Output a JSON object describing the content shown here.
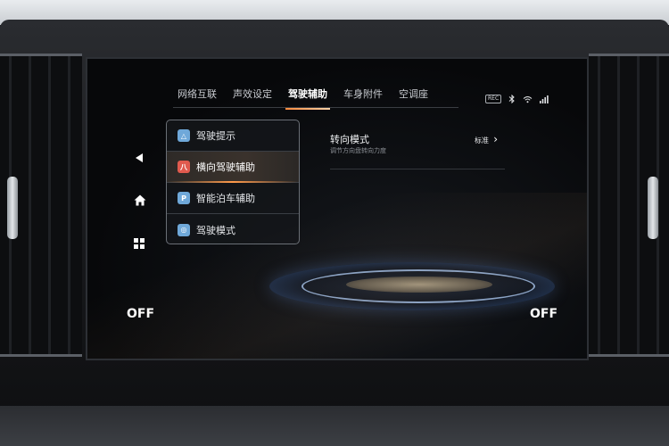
{
  "tabs": [
    {
      "label": "网络互联"
    },
    {
      "label": "声效设定"
    },
    {
      "label": "驾驶辅助",
      "active": true
    },
    {
      "label": "车身附件"
    },
    {
      "label": "空调座"
    }
  ],
  "status_bar": {
    "rec_label": "REC",
    "icons": [
      "bluetooth-icon",
      "wifi-icon",
      "signal-icon"
    ]
  },
  "rail": {
    "icons": [
      "back-icon",
      "home-icon",
      "apps-grid-icon"
    ]
  },
  "menu": {
    "items": [
      {
        "label": "驾驶提示",
        "icon": "warning-triangle-icon",
        "icon_glyph": "△",
        "color": "#6fa8d9"
      },
      {
        "label": "横向驾驶辅助",
        "icon": "lane-assist-icon",
        "icon_glyph": "八",
        "color": "#e05a4e",
        "active": true
      },
      {
        "label": "智能泊车辅助",
        "icon": "parking-icon",
        "icon_glyph": "P",
        "color": "#6fa8d9"
      },
      {
        "label": "驾驶模式",
        "icon": "drive-mode-icon",
        "icon_glyph": "◎",
        "color": "#6fa8d9"
      }
    ]
  },
  "setting": {
    "title": "转向模式",
    "subtitle": "调节方向盘转向力度",
    "value": "标准",
    "chevron": "›"
  },
  "climate": {
    "left_label": "OFF",
    "right_label": "OFF"
  },
  "colors": {
    "accent": "#ff9a4a",
    "menu_icon_blue": "#6fa8d9",
    "menu_icon_red": "#e05a4e"
  }
}
